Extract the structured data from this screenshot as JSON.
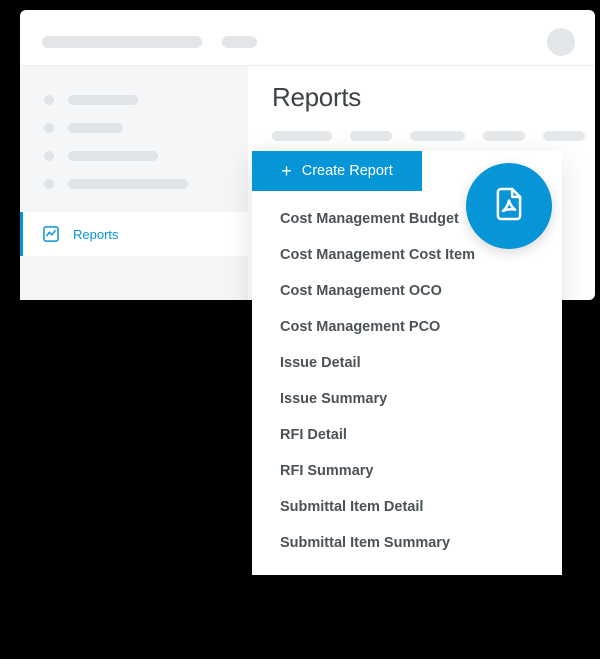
{
  "sidebar": {
    "active": {
      "label": "Reports"
    }
  },
  "main": {
    "title": "Reports"
  },
  "dropdown": {
    "button_label": "Create Report",
    "items": [
      "Cost Management Budget",
      "Cost Management Cost Item",
      "Cost Management OCO",
      "Cost Management PCO",
      "Issue Detail",
      "Issue Summary",
      "RFI Detail",
      "RFI Summary",
      "Submittal Item Detail",
      "Submittal Item Summary"
    ]
  },
  "colors": {
    "accent": "#0696d7"
  }
}
